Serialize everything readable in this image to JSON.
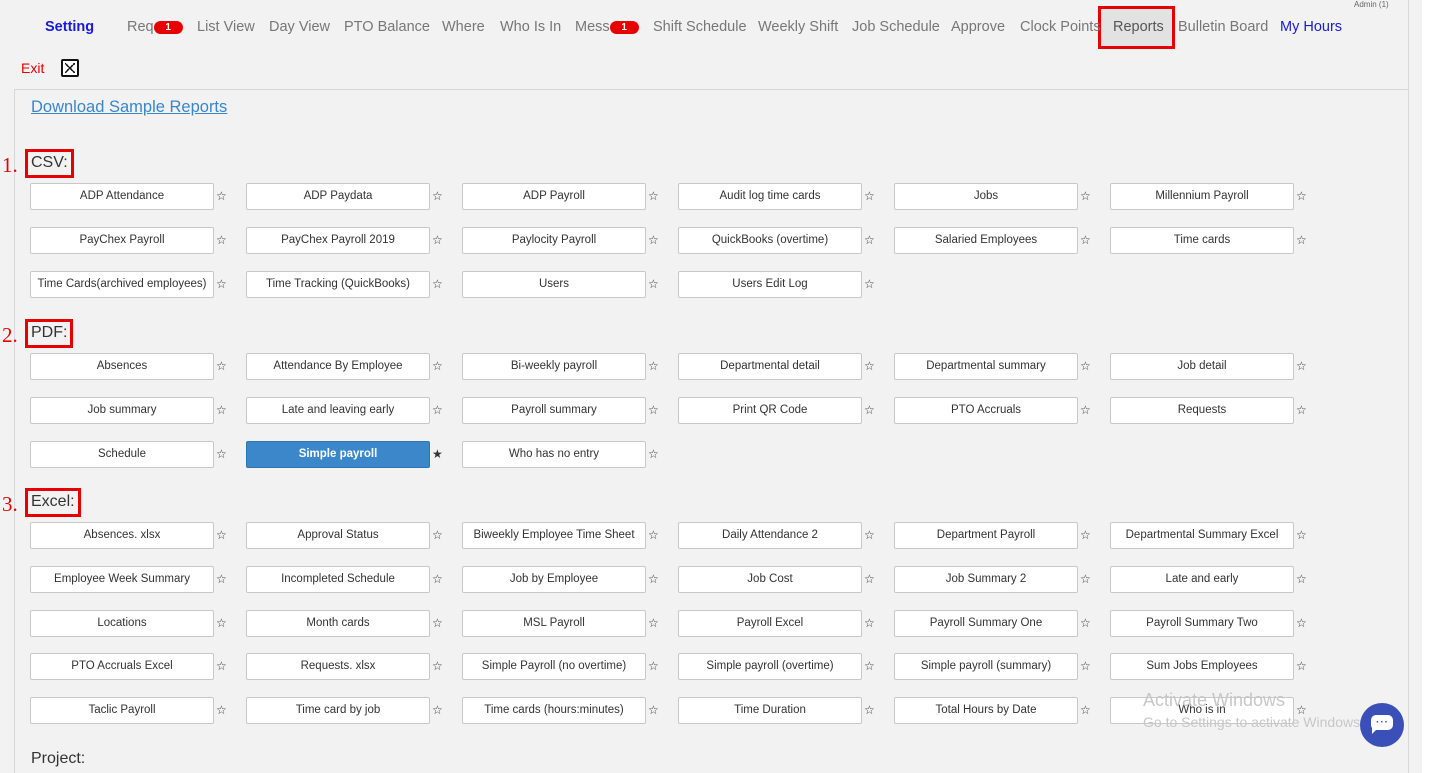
{
  "header": {
    "admin_label": "Admin (1)",
    "nav": [
      {
        "label": "Setting",
        "badge": null
      },
      {
        "label": "Req",
        "badge": "1"
      },
      {
        "label": "List View",
        "badge": null
      },
      {
        "label": "Day View",
        "badge": null
      },
      {
        "label": "PTO Balance",
        "badge": null
      },
      {
        "label": "Where",
        "badge": null
      },
      {
        "label": "Who Is In",
        "badge": null
      },
      {
        "label": "Mess",
        "badge": "1"
      },
      {
        "label": "Shift Schedule",
        "badge": null
      },
      {
        "label": "Weekly Shift",
        "badge": null
      },
      {
        "label": "Job Schedule",
        "badge": null
      },
      {
        "label": "Approve",
        "badge": null
      },
      {
        "label": "Clock Points",
        "badge": null
      },
      {
        "label": "Reports",
        "badge": null
      },
      {
        "label": "Bulletin Board",
        "badge": null
      },
      {
        "label": "My Hours",
        "badge": null
      }
    ],
    "exit_label": "Exit"
  },
  "main": {
    "download_link": "Download Sample Reports",
    "sections": [
      {
        "number": "1.",
        "label": "CSV:",
        "reports": [
          "ADP Attendance",
          "ADP Paydata",
          "ADP Payroll",
          "Audit log time cards",
          "Jobs",
          "Millennium Payroll",
          "PayChex Payroll",
          "PayChex Payroll 2019",
          "Paylocity Payroll",
          "QuickBooks (overtime)",
          "Salaried Employees",
          "Time cards",
          "Time Cards(archived employees)",
          "Time Tracking (QuickBooks)",
          "Users",
          "Users Edit Log"
        ]
      },
      {
        "number": "2.",
        "label": "PDF:",
        "reports": [
          "Absences",
          "Attendance By Employee",
          "Bi-weekly payroll",
          "Departmental detail",
          "Departmental summary",
          "Job detail",
          "Job summary",
          "Late and leaving early",
          "Payroll summary",
          "Print QR Code",
          "PTO Accruals",
          "Requests",
          "Schedule",
          "Simple payroll",
          "Who has no entry"
        ]
      },
      {
        "number": "3.",
        "label": "Excel:",
        "reports": [
          "Absences. xlsx",
          "Approval Status",
          "Biweekly Employee Time Sheet",
          "Daily Attendance 2",
          "Department Payroll",
          "Departmental Summary Excel",
          "Employee Week Summary",
          "Incompleted Schedule",
          "Job by Employee",
          "Job Cost",
          "Job Summary 2",
          "Late and early",
          "Locations",
          "Month cards",
          "MSL Payroll",
          "Payroll Excel",
          "Payroll Summary One",
          "Payroll Summary Two",
          "PTO Accruals Excel",
          "Requests. xlsx",
          "Simple Payroll (no overtime)",
          "Simple payroll (overtime)",
          "Simple payroll (summary)",
          "Sum Jobs Employees",
          "Taclic Payroll",
          "Time card by job",
          "Time cards (hours:minutes)",
          "Time Duration",
          "Total Hours by Date",
          "Who is in"
        ]
      }
    ],
    "active_report": "Simple payroll",
    "star_empty": "☆",
    "star_filled": "★",
    "project_label": "Project:"
  },
  "overlay": {
    "watermark_title": "Activate Windows",
    "watermark_sub": "Go to Settings to activate Windows.",
    "chat_icon": "chat-bubble-icon"
  },
  "colors": {
    "accent_blue": "#3b87c9",
    "highlight_red": "#e60000",
    "nav_active": "#1a1ad6"
  }
}
